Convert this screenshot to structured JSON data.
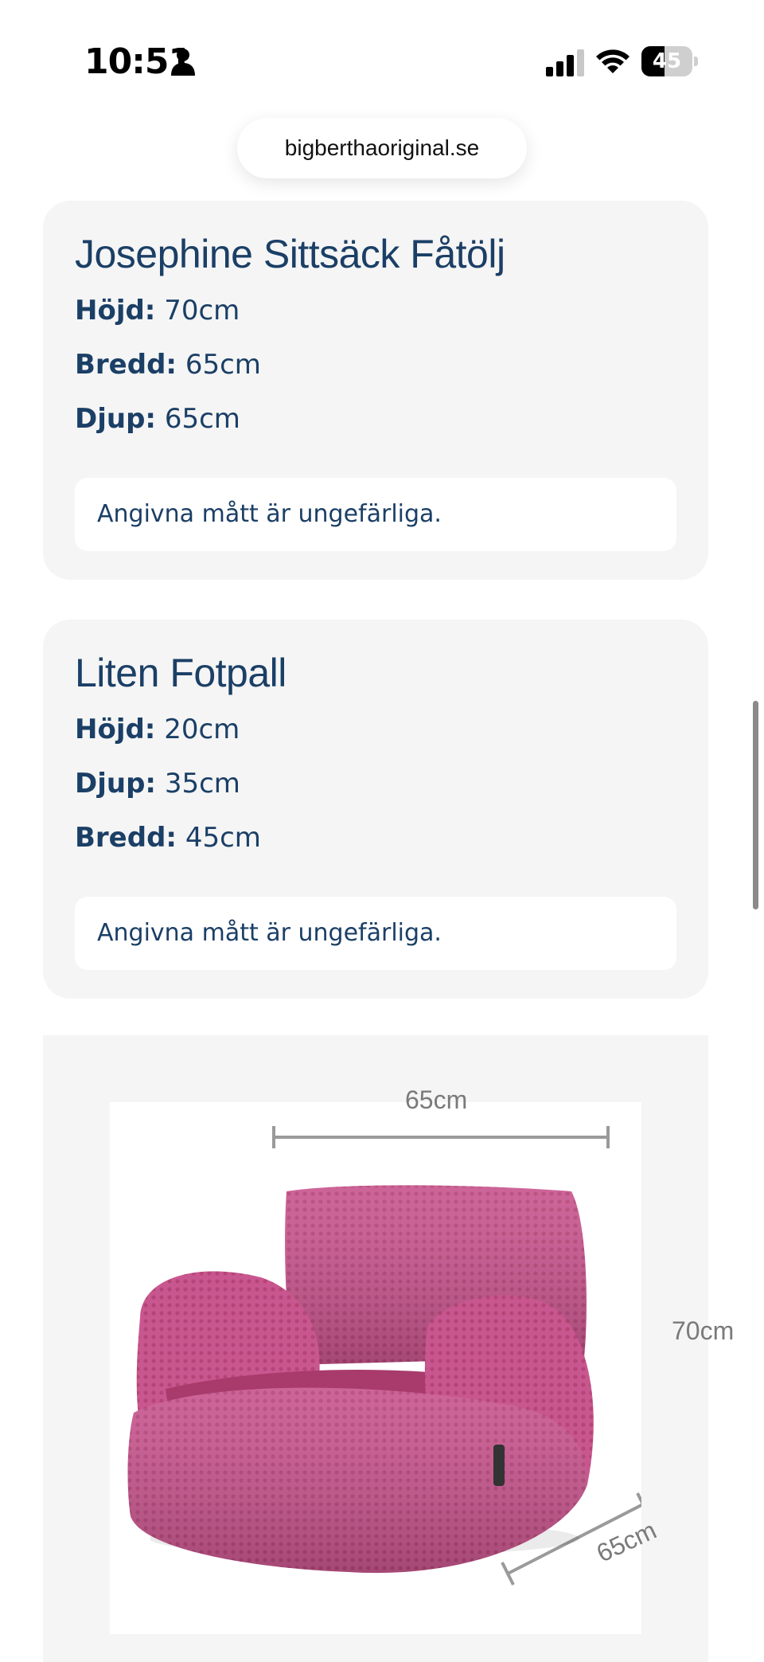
{
  "status_bar": {
    "time": "10:51",
    "battery_level": "45"
  },
  "browser": {
    "url": "bigberthaoriginal.se"
  },
  "products": [
    {
      "title": "Josephine Sittsäck Fåtölj",
      "specs": [
        {
          "label": "Höjd:",
          "value": "70cm"
        },
        {
          "label": "Bredd:",
          "value": "65cm"
        },
        {
          "label": "Djup:",
          "value": "65cm"
        }
      ],
      "note": "Angivna mått är ungefärliga."
    },
    {
      "title": "Liten Fotpall",
      "specs": [
        {
          "label": "Höjd:",
          "value": "20cm"
        },
        {
          "label": "Djup:",
          "value": "35cm"
        },
        {
          "label": "Bredd:",
          "value": "45cm"
        }
      ],
      "note": "Angivna mått är ungefärliga."
    }
  ],
  "product_image": {
    "width_label": "65cm",
    "height_label": "70cm",
    "depth_label": "65cm",
    "chair_color": "#c9578f"
  },
  "colors": {
    "text_primary": "#1b3f66",
    "card_bg": "#f5f5f5"
  }
}
